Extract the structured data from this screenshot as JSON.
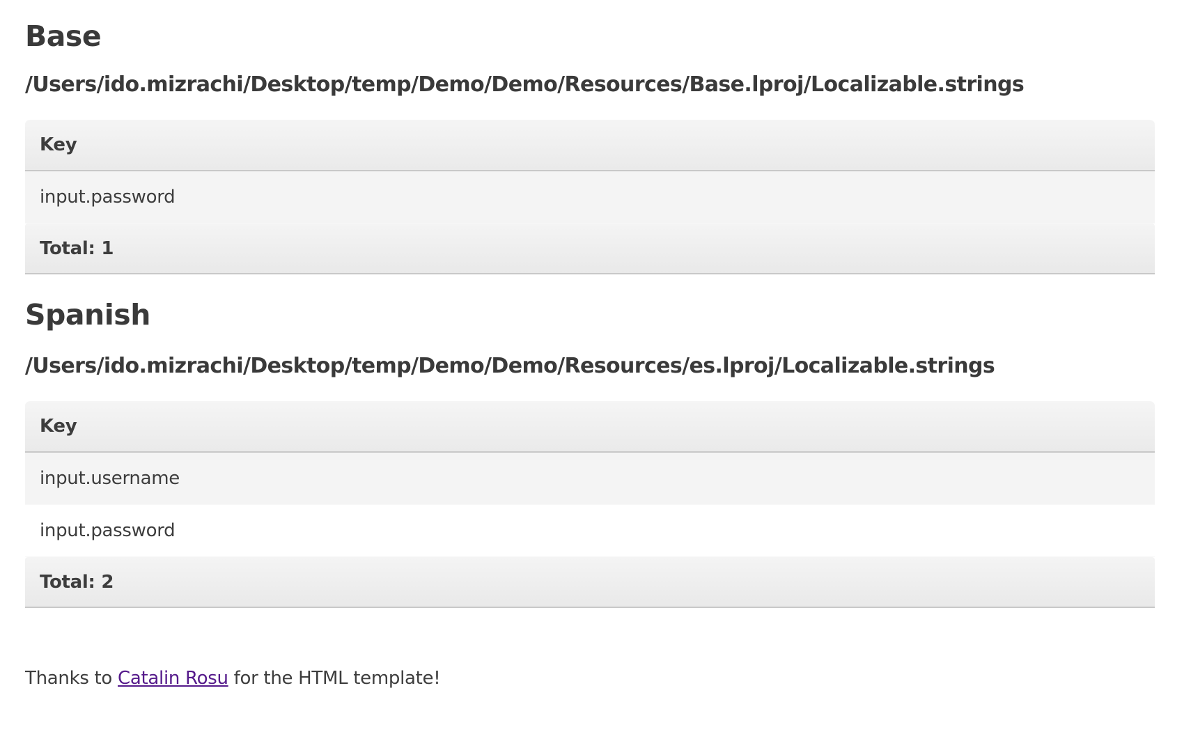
{
  "sections": [
    {
      "title": "Base",
      "path": "/Users/ido.mizrachi/Desktop/temp/Demo/Demo/Resources/Base.lproj/Localizable.strings",
      "column_header": "Key",
      "rows": [
        "input.password"
      ],
      "total": "Total: 1"
    },
    {
      "title": "Spanish",
      "path": "/Users/ido.mizrachi/Desktop/temp/Demo/Demo/Resources/es.lproj/Localizable.strings",
      "column_header": "Key",
      "rows": [
        "input.username",
        "input.password"
      ],
      "total": "Total: 2"
    }
  ],
  "footer": {
    "prefix": "Thanks to ",
    "link_text": "Catalin Rosu",
    "suffix": " for the HTML template!"
  },
  "colors": {
    "text": "#3d3d3d",
    "link": "#551a8b",
    "header_bg": "#eeeeee",
    "odd_row_bg": "#f4f4f4",
    "border": "#c8c8c8"
  }
}
